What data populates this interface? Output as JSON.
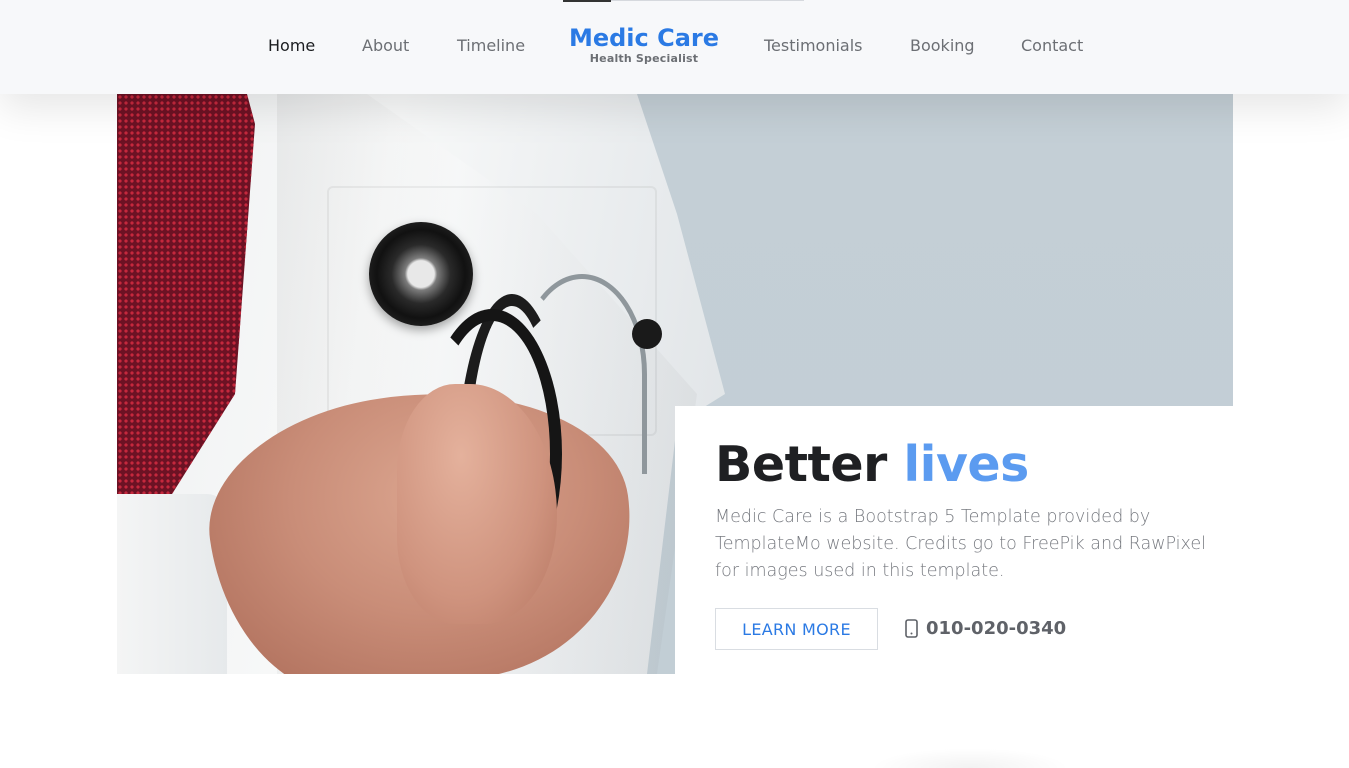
{
  "nav": {
    "items": [
      {
        "label": "Home",
        "active": true
      },
      {
        "label": "About"
      },
      {
        "label": "Timeline"
      },
      {
        "label": "Testimonials"
      },
      {
        "label": "Booking"
      },
      {
        "label": "Contact"
      }
    ],
    "brand": {
      "title": "Medic Care",
      "subtitle": "Health Specialist"
    }
  },
  "hero": {
    "image": {
      "icon": "doctor-with-stethoscope-photo"
    },
    "headline": {
      "main": "Better",
      "accent": "lives"
    },
    "description": "Medic Care is a Bootstrap 5 Template provided by TemplateMo website. Credits go to FreePik and RawPixel for images used in this template.",
    "cta_label": "LEARN MORE",
    "phone": {
      "icon": "mobile-phone-icon",
      "number": "010-020-0340"
    }
  },
  "colors": {
    "brand": "#2b7ae4",
    "accent": "#5b9bf0",
    "navbar_bg": "#f7f8fa",
    "hero_bg": "#c4cfd6"
  }
}
